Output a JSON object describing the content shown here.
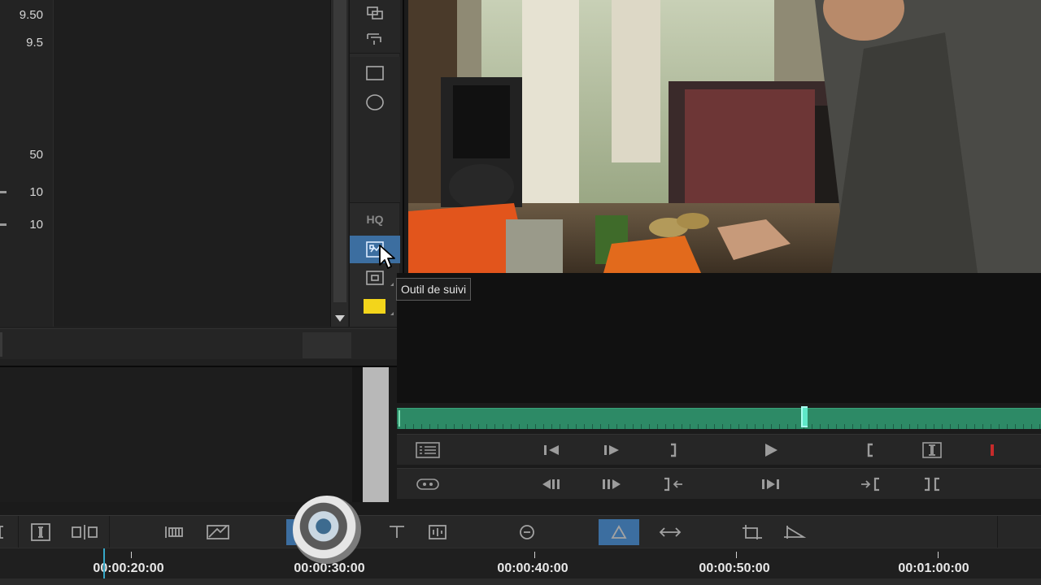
{
  "properties": {
    "values": [
      "9.50",
      "9.5",
      "50",
      "10",
      "10"
    ]
  },
  "tool_strip": {
    "hq_label": "HQ",
    "active_tool": "tracking-tool",
    "swatch_color": "#f3d51b"
  },
  "tooltip": {
    "text": "Outil de suivi"
  },
  "timeline": {
    "ruler_labels": [
      "00:00:20:00",
      "00:00:30:00",
      "00:00:40:00",
      "00:00:50:00",
      "00:01:00:00"
    ]
  },
  "colors": {
    "accent_blue": "#3c6ea0",
    "scrubber_green": "#2d8a66",
    "playhead_cyan": "#5fe8c8",
    "record_red": "#c62b2b"
  }
}
